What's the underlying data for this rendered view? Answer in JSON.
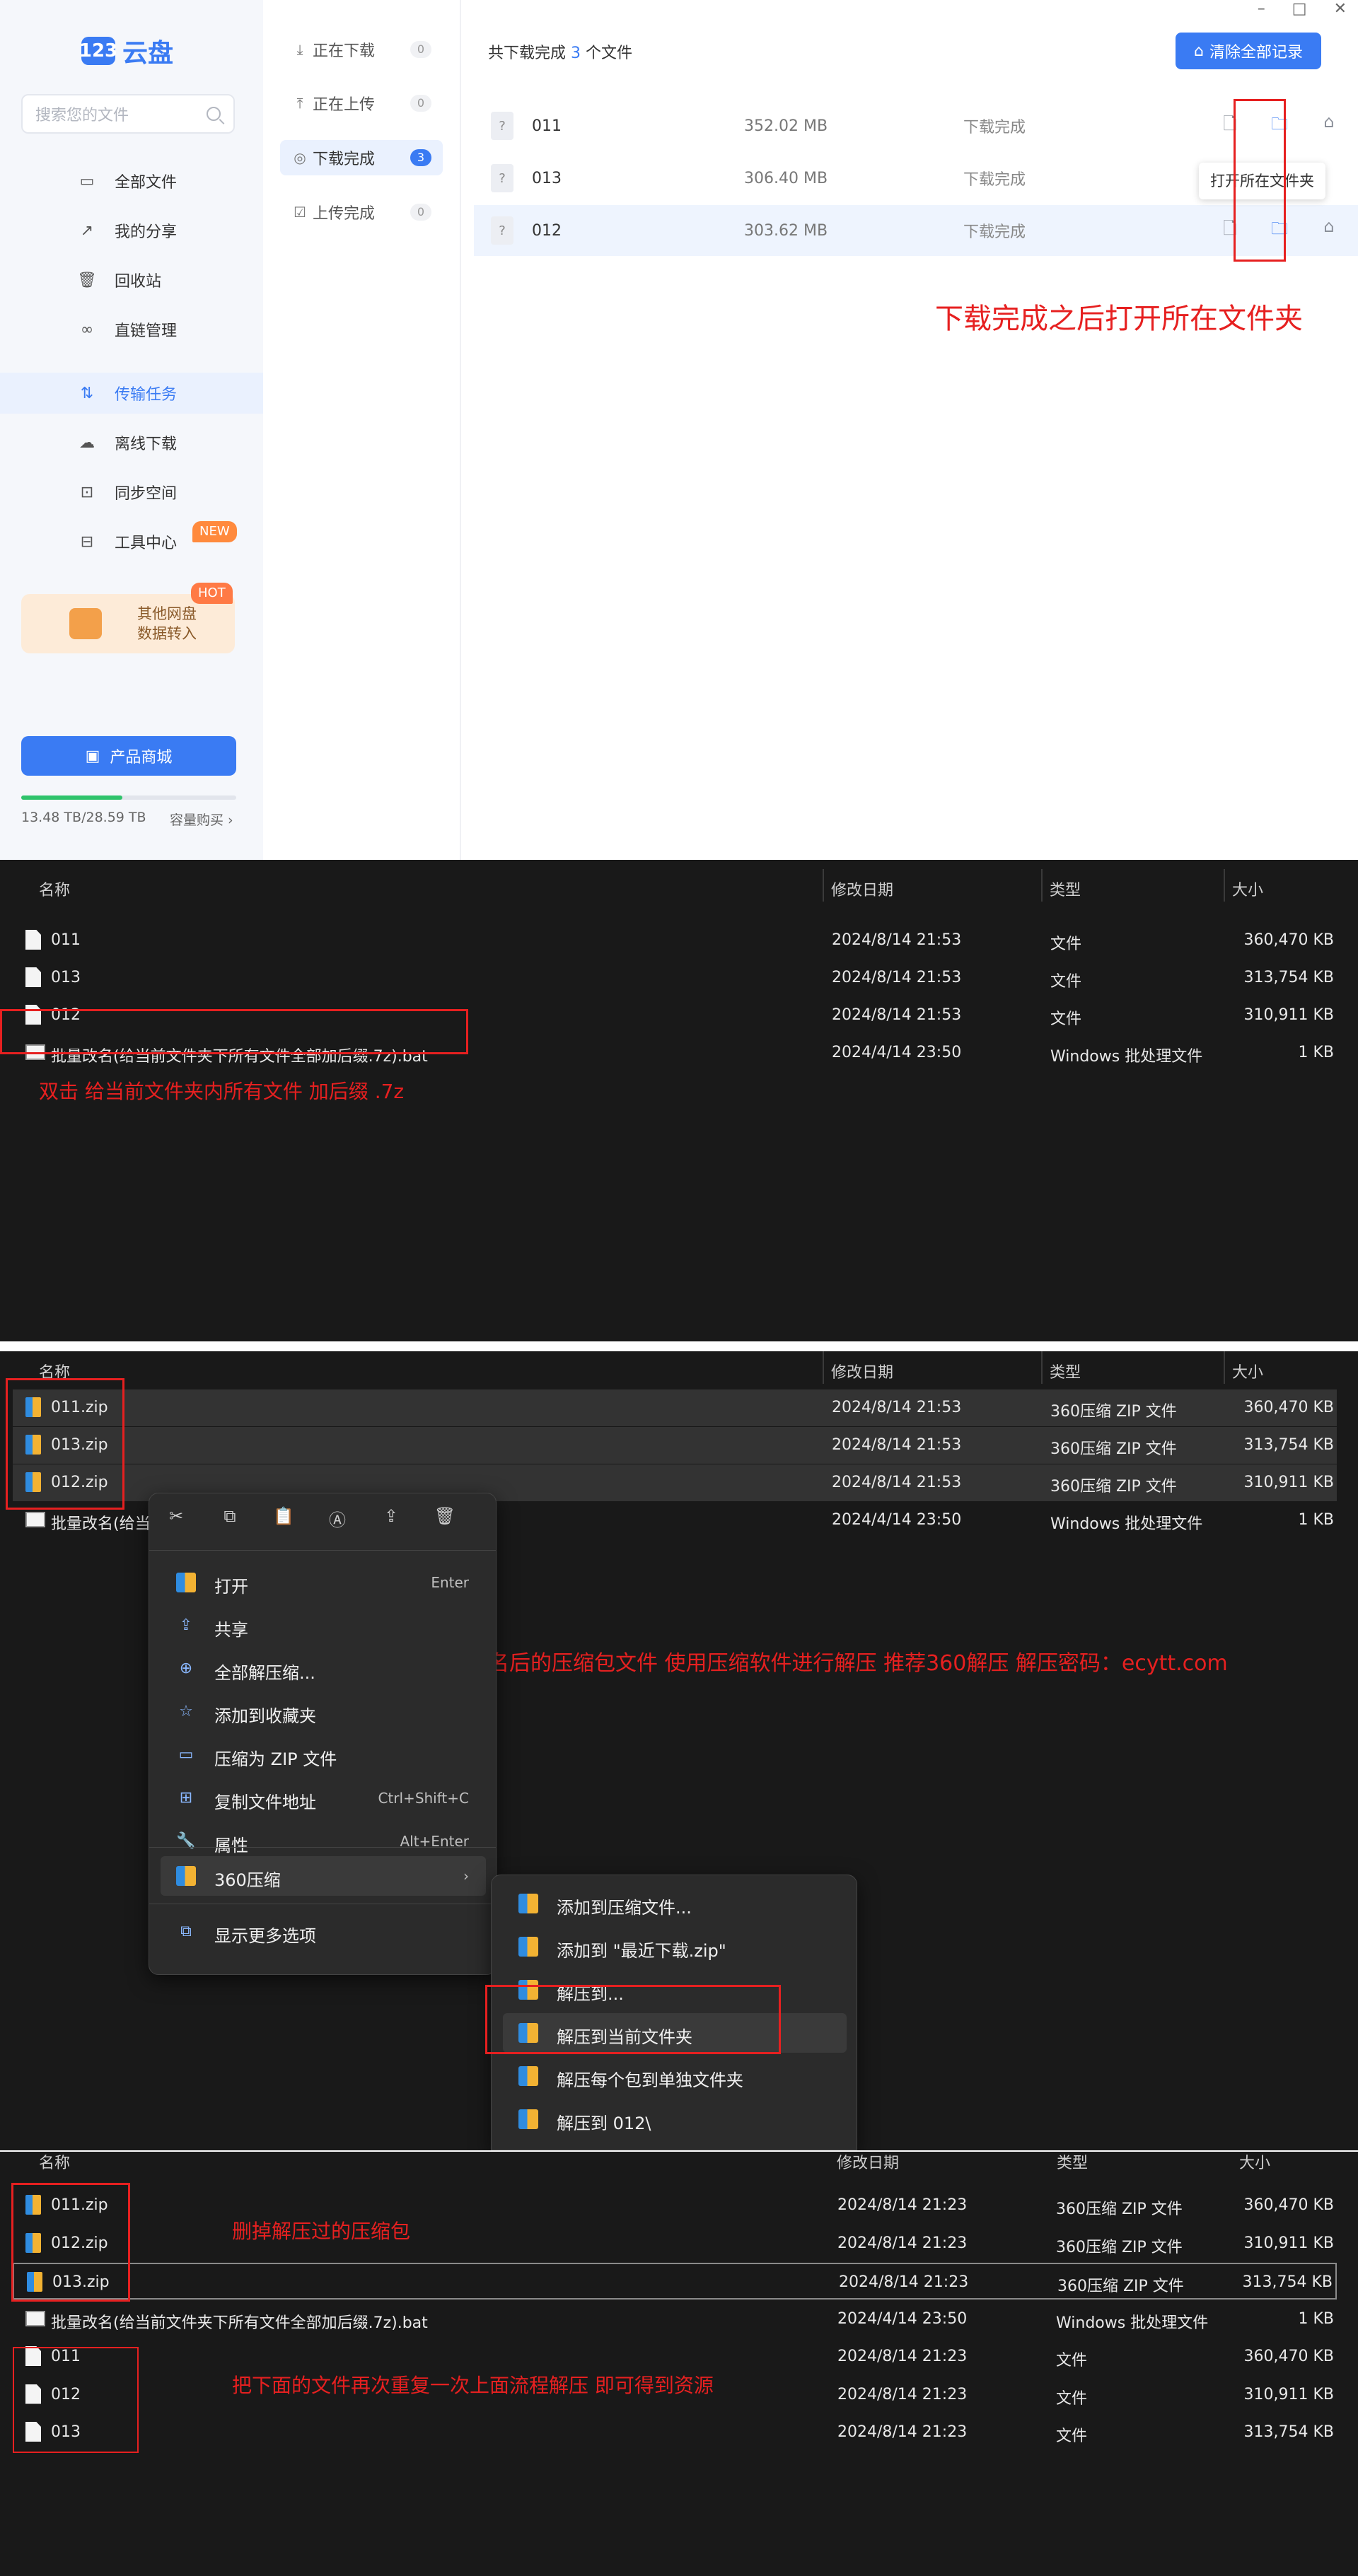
{
  "cloud": {
    "logo_badge": "123",
    "logo_text": "云盘",
    "search_placeholder": "搜索您的文件",
    "nav": [
      {
        "label": "全部文件",
        "icon": "folder-icon"
      },
      {
        "label": "我的分享",
        "icon": "share-icon"
      },
      {
        "label": "回收站",
        "icon": "trash-icon"
      },
      {
        "label": "直链管理",
        "icon": "link-icon"
      },
      {
        "label": "传输任务",
        "icon": "transfer-icon",
        "active": true
      },
      {
        "label": "离线下载",
        "icon": "cloud-download-icon"
      },
      {
        "label": "同步空间",
        "icon": "sync-icon"
      },
      {
        "label": "工具中心",
        "icon": "toolbox-icon"
      }
    ],
    "new_badge": "NEW",
    "promo_line1": "其他网盘",
    "promo_line2": "数据转入",
    "hot_badge": "HOT",
    "store_button": "产品商城",
    "usage_text": "13.48 TB/28.59 TB",
    "usage_fraction": 0.47,
    "usage_buy": "容量购买",
    "tasks": [
      {
        "label": "正在下载",
        "count": "0"
      },
      {
        "label": "正在上传",
        "count": "0"
      },
      {
        "label": "下载完成",
        "count": "3",
        "active": true
      },
      {
        "label": "上传完成",
        "count": "0"
      }
    ],
    "summary_prefix": "共下载完成",
    "summary_count": "3",
    "summary_suffix": "个文件",
    "clear_button": "清除全部记录",
    "files": [
      {
        "name": "011",
        "size": "352.02 MB",
        "status": "下载完成"
      },
      {
        "name": "013",
        "size": "306.40 MB",
        "status": "下载完成"
      },
      {
        "name": "012",
        "size": "303.62 MB",
        "status": "下载完成"
      }
    ],
    "file_icon_text": "?",
    "tooltip": "打开所在文件夹",
    "note": "下载完成之后打开所在文件夹"
  },
  "headers": {
    "name": "名称",
    "date": "修改日期",
    "type": "类型",
    "size": "大小"
  },
  "panel2": {
    "rows": [
      {
        "name": "011",
        "date": "2024/8/14 21:53",
        "type": "文件",
        "size": "360,470 KB",
        "icon": "doc"
      },
      {
        "name": "013",
        "date": "2024/8/14 21:53",
        "type": "文件",
        "size": "313,754 KB",
        "icon": "doc"
      },
      {
        "name": "012",
        "date": "2024/8/14 21:53",
        "type": "文件",
        "size": "310,911 KB",
        "icon": "doc"
      },
      {
        "name": "批量改名(给当前文件夹下所有文件全部加后缀.7z).bat",
        "date": "2024/4/14 23:50",
        "type": "Windows 批处理文件",
        "size": "1 KB",
        "icon": "bat"
      }
    ],
    "note": "双击 给当前文件夹内所有文件 加后缀 .7z"
  },
  "panel3": {
    "rows": [
      {
        "name": "011.zip",
        "date": "2024/8/14 21:53",
        "type": "360压缩 ZIP 文件",
        "size": "360,470 KB",
        "icon": "zip"
      },
      {
        "name": "013.zip",
        "date": "2024/8/14 21:53",
        "type": "360压缩 ZIP 文件",
        "size": "313,754 KB",
        "icon": "zip"
      },
      {
        "name": "012.zip",
        "date": "2024/8/14 21:53",
        "type": "360压缩 ZIP 文件",
        "size": "310,911 KB",
        "icon": "zip"
      },
      {
        "name": "批量改名(给当",
        "date": "2024/4/14 23:50",
        "type": "Windows 批处理文件",
        "size": "1 KB",
        "icon": "bat"
      }
    ],
    "context_menu": [
      {
        "label": "打开",
        "shortcut": "Enter",
        "icon": "zip"
      },
      {
        "label": "共享",
        "shortcut": "",
        "icon": "share-icon"
      },
      {
        "label": "全部解压缩...",
        "shortcut": "",
        "icon": "extract-icon"
      },
      {
        "label": "添加到收藏夹",
        "shortcut": "",
        "icon": "star-icon"
      },
      {
        "label": "压缩为 ZIP 文件",
        "shortcut": "",
        "icon": "zip-folder-icon"
      },
      {
        "label": "复制文件地址",
        "shortcut": "Ctrl+Shift+C",
        "icon": "copy-path-icon"
      },
      {
        "label": "属性",
        "shortcut": "Alt+Enter",
        "icon": "wrench-icon"
      }
    ],
    "menu_360": "360压缩",
    "menu_more": "显示更多选项",
    "submenu": [
      "添加到压缩文件...",
      "添加到 \"最近下载.zip\"",
      "解压到...",
      "解压到当前文件夹",
      "解压每个包到单独文件夹",
      "解压到 012\\"
    ],
    "note": "全选改名后的压缩包文件 使用压缩软件进行解压 推荐360解压 解压密码：ecytt.com"
  },
  "panel4": {
    "rows": [
      {
        "name": "011.zip",
        "date": "2024/8/14 21:23",
        "type": "360压缩 ZIP 文件",
        "size": "360,470 KB",
        "icon": "zip"
      },
      {
        "name": "012.zip",
        "date": "2024/8/14 21:23",
        "type": "360压缩 ZIP 文件",
        "size": "310,911 KB",
        "icon": "zip"
      },
      {
        "name": "013.zip",
        "date": "2024/8/14 21:23",
        "type": "360压缩 ZIP 文件",
        "size": "313,754 KB",
        "icon": "zip"
      },
      {
        "name": "批量改名(给当前文件夹下所有文件全部加后缀.7z).bat",
        "date": "2024/4/14 23:50",
        "type": "Windows 批处理文件",
        "size": "1 KB",
        "icon": "bat"
      },
      {
        "name": "011",
        "date": "2024/8/14 21:23",
        "type": "文件",
        "size": "360,470 KB",
        "icon": "doc"
      },
      {
        "name": "012",
        "date": "2024/8/14 21:23",
        "type": "文件",
        "size": "310,911 KB",
        "icon": "doc"
      },
      {
        "name": "013",
        "date": "2024/8/14 21:23",
        "type": "文件",
        "size": "313,754 KB",
        "icon": "doc"
      }
    ],
    "note1": "删掉解压过的压缩包",
    "note2": "把下面的文件再次重复一次上面流程解压 即可得到资源"
  },
  "colors": {
    "accent": "#3a7bf3",
    "annotation": "#e62020",
    "explorer_bg": "#191919"
  }
}
